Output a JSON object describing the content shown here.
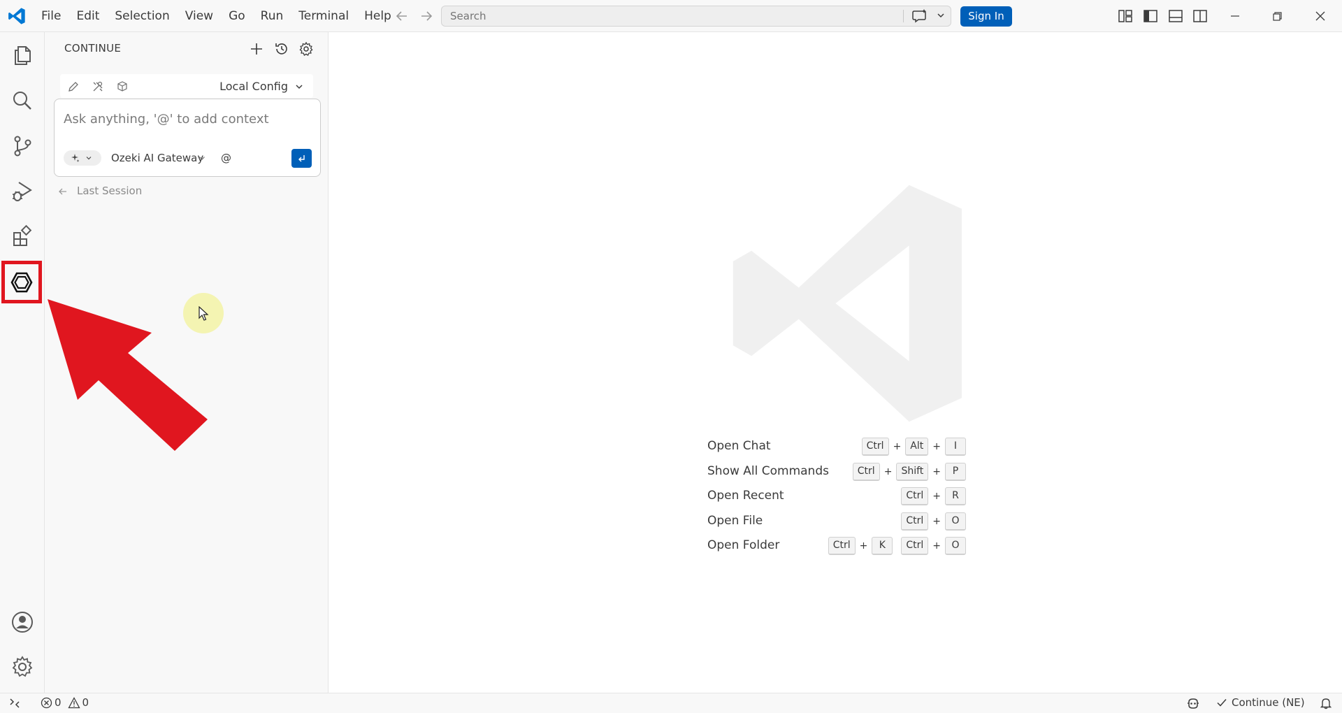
{
  "menu": [
    "File",
    "Edit",
    "Selection",
    "View",
    "Go",
    "Run",
    "Terminal",
    "Help"
  ],
  "search": {
    "placeholder": "Search"
  },
  "titlebar": {
    "sign_in": "Sign In"
  },
  "sidebar": {
    "title": "CONTINUE",
    "config": "Local Config",
    "chat_placeholder": "Ask anything, '@' to add context",
    "model": "Ozeki AI Gateway",
    "at_symbol": "@",
    "last_session": "Last Session"
  },
  "shortcuts": [
    {
      "label": "Open Chat",
      "keys": [
        [
          "Ctrl",
          "Alt",
          "I"
        ]
      ]
    },
    {
      "label": "Show All Commands",
      "keys": [
        [
          "Ctrl",
          "Shift",
          "P"
        ]
      ]
    },
    {
      "label": "Open Recent",
      "keys": [
        [
          "Ctrl",
          "R"
        ]
      ]
    },
    {
      "label": "Open File",
      "keys": [
        [
          "Ctrl",
          "O"
        ]
      ]
    },
    {
      "label": "Open Folder",
      "keys": [
        [
          "Ctrl",
          "K"
        ],
        [
          "Ctrl",
          "O"
        ]
      ]
    }
  ],
  "statusbar": {
    "errors": "0",
    "warnings": "0",
    "continue": "Continue (NE)"
  },
  "colors": {
    "accent": "#005fb8",
    "annotation_red": "#e0161f",
    "cursor_highlight": "#f0f078"
  },
  "icons": {
    "activity_bar": [
      "explorer-icon",
      "search-icon",
      "source-control-icon",
      "run-debug-icon",
      "extensions-icon",
      "continue-icon",
      "account-icon",
      "manage-gear-icon"
    ]
  }
}
